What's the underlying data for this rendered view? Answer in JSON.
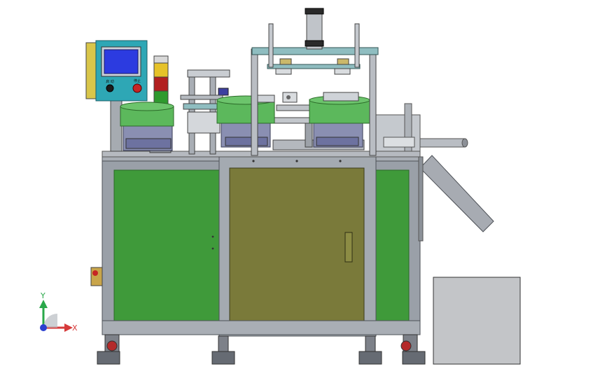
{
  "viewport": {
    "background": "#ffffff",
    "triad": {
      "y_label": "Y",
      "x_label": "X",
      "y_color": "#2aa84a",
      "x_color": "#d63a3a",
      "z_color": "#2b3fcf"
    }
  },
  "control_panel": {
    "button_left_label": "启 动",
    "button_right_label": "停止",
    "screen_color": "#2c3be0",
    "box_color": "#2ea7b5"
  },
  "tower_light": {
    "colors": [
      "#d8d8d8",
      "#e6c229",
      "#b22020",
      "#2f9a2f"
    ]
  },
  "machine": {
    "frame_color": "#9aa0a8",
    "side_panel_color": "#3f9a3a",
    "door_color": "#7a7a3a",
    "bowl_band_color": "#5cb85c",
    "bowl_body_color": "#8a8fb2"
  }
}
